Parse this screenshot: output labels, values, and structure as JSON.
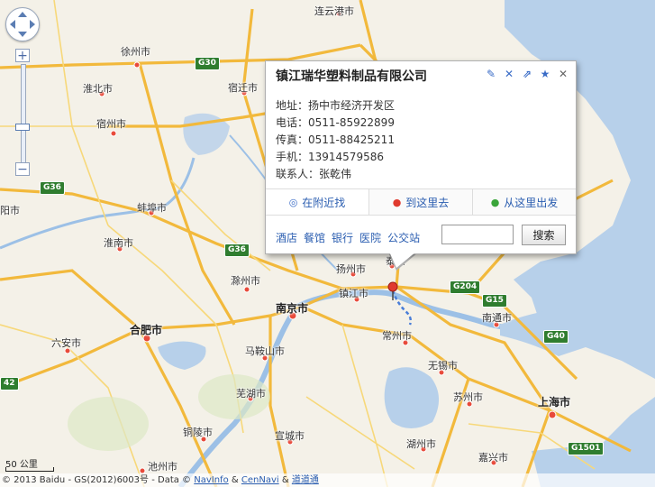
{
  "colors": {
    "water": "#b7d0ea",
    "land": "#f4f1e8",
    "highway": "#f2b93c",
    "road": "#f7d87a",
    "park": "#dde8c6",
    "marker": "#e03a2e",
    "route": "#4a7ed8"
  },
  "cities": [
    {
      "name": "连云港市",
      "big": false
    },
    {
      "name": "徐州市",
      "big": false
    },
    {
      "name": "淮北市",
      "big": false
    },
    {
      "name": "宿迁市",
      "big": false
    },
    {
      "name": "宿州市",
      "big": false
    },
    {
      "name": "蚌埠市",
      "big": false
    },
    {
      "name": "淮南市",
      "big": false
    },
    {
      "name": "滁州市",
      "big": false
    },
    {
      "name": "扬州市",
      "big": false
    },
    {
      "name": "泰州",
      "big": false
    },
    {
      "name": "镇江市",
      "big": false
    },
    {
      "name": "南京市",
      "big": true
    },
    {
      "name": "南通市",
      "big": false
    },
    {
      "name": "合肥市",
      "big": true
    },
    {
      "name": "六安市",
      "big": false
    },
    {
      "name": "马鞍山市",
      "big": false
    },
    {
      "name": "常州市",
      "big": false
    },
    {
      "name": "无锡市",
      "big": false
    },
    {
      "name": "芜湖市",
      "big": false
    },
    {
      "name": "苏州市",
      "big": false
    },
    {
      "name": "上海市",
      "big": true
    },
    {
      "name": "铜陵市",
      "big": false
    },
    {
      "name": "宣城市",
      "big": false
    },
    {
      "name": "湖州市",
      "big": false
    },
    {
      "name": "嘉兴市",
      "big": false
    },
    {
      "name": "池州市",
      "big": false
    },
    {
      "name": "阳市",
      "big": false
    }
  ],
  "shields": [
    "G30",
    "G36",
    "G36",
    "G204",
    "G15",
    "G40",
    "G1501",
    "42"
  ],
  "info": {
    "title": "镇江瑞华塑料制品有限公司",
    "tools": [
      "edit-icon",
      "delete-icon",
      "share-icon",
      "star-icon",
      "close-icon"
    ],
    "rows": [
      "地址：扬中市经济开发区",
      "电话：0511-85922899",
      "传真：0511-88425211",
      "手机：13914579586",
      "联系人：张乾伟"
    ],
    "tabs": [
      {
        "label": "在附近找",
        "icon": "search-icon"
      },
      {
        "label": "到这里去",
        "icon": "pin-red-icon"
      },
      {
        "label": "从这里出发",
        "icon": "pin-green-icon"
      }
    ],
    "links": [
      "酒店",
      "餐馆",
      "银行",
      "医院",
      "公交站"
    ],
    "search_value": "",
    "search_button": "搜索"
  },
  "scale": "50 公里",
  "copyright": {
    "text": "© 2013 Baidu - GS(2012)6003号 - Data ©",
    "navinfo": "NavInfo",
    "amp1": "&",
    "cennavi": "CenNavi",
    "amp2": "&",
    "daodaotong": "道道通"
  }
}
